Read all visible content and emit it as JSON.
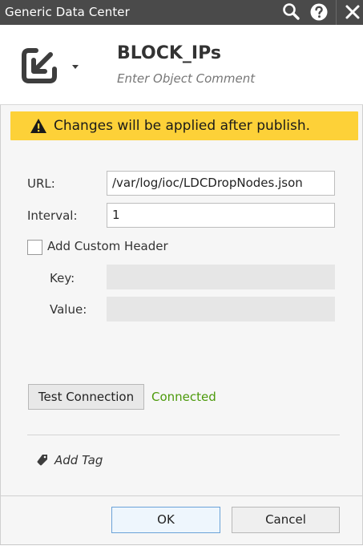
{
  "window": {
    "title": "Generic Data Center",
    "icons": [
      "search-icon",
      "help-icon",
      "close-icon"
    ]
  },
  "object": {
    "name": "BLOCK_IPs",
    "comment_placeholder": "Enter Object Comment",
    "icon": "import-arrow-icon"
  },
  "warning": {
    "text": "Changes will be applied after publish.",
    "color": "#fdd138"
  },
  "form": {
    "url_label": "URL:",
    "url_value": "/var/log/ioc/LDCDropNodes.json",
    "interval_label": "Interval:",
    "interval_value": "1",
    "custom_header_label": "Add Custom Header",
    "custom_header_checked": false,
    "key_label": "Key:",
    "key_value": "",
    "value_label": "Value:",
    "value_value": ""
  },
  "connection": {
    "test_label": "Test Connection",
    "status": "Connected",
    "status_color": "#4c9a0b"
  },
  "tags": {
    "add_label": "Add Tag"
  },
  "footer": {
    "ok_label": "OK",
    "cancel_label": "Cancel"
  }
}
